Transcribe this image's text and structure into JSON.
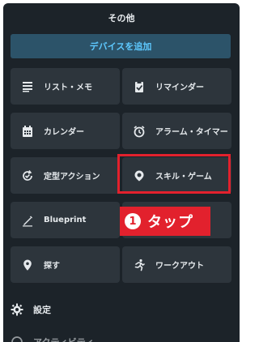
{
  "header": {
    "title": "その他"
  },
  "add_device_label": "デバイスを追加",
  "tiles": [
    {
      "label": "リスト・メモ",
      "icon": "list-icon"
    },
    {
      "label": "リマインダー",
      "icon": "clipboard-check-icon"
    },
    {
      "label": "カレンダー",
      "icon": "calendar-icon"
    },
    {
      "label": "アラーム・タイマー",
      "icon": "alarm-clock-icon"
    },
    {
      "label": "定型アクション",
      "icon": "routine-icon"
    },
    {
      "label": "スキル・ゲーム",
      "icon": "skills-icon"
    },
    {
      "label": "Blueprint",
      "icon": "pen-icon"
    },
    {
      "label": "",
      "icon": ""
    },
    {
      "label": "探す",
      "icon": "location-pin-icon"
    },
    {
      "label": "ワークアウト",
      "icon": "running-icon"
    }
  ],
  "settings": {
    "label": "設定",
    "icon": "gear-icon"
  },
  "next_item": {
    "label": "アクティビティ",
    "icon": "clock-icon"
  },
  "callout": {
    "number": "1",
    "text": "タップ"
  },
  "colors": {
    "accent": "#e2212d",
    "button_text": "#5ec9ff"
  }
}
